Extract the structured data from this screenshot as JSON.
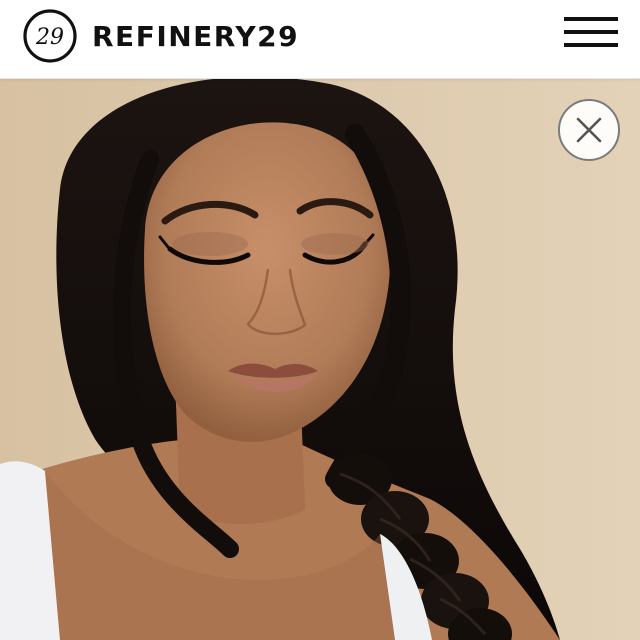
{
  "header": {
    "brand_name": "REFINERY29",
    "logo_mark_text": "29",
    "menu_icon": "hamburger-menu-icon"
  },
  "hero": {
    "image_subject": "portrait-photo",
    "close_icon": "close-icon"
  },
  "colors": {
    "header_bg": "#ffffff",
    "brand_text": "#111111",
    "hero_bg": "#d9c5a8",
    "close_border": "#7b7b7b"
  }
}
